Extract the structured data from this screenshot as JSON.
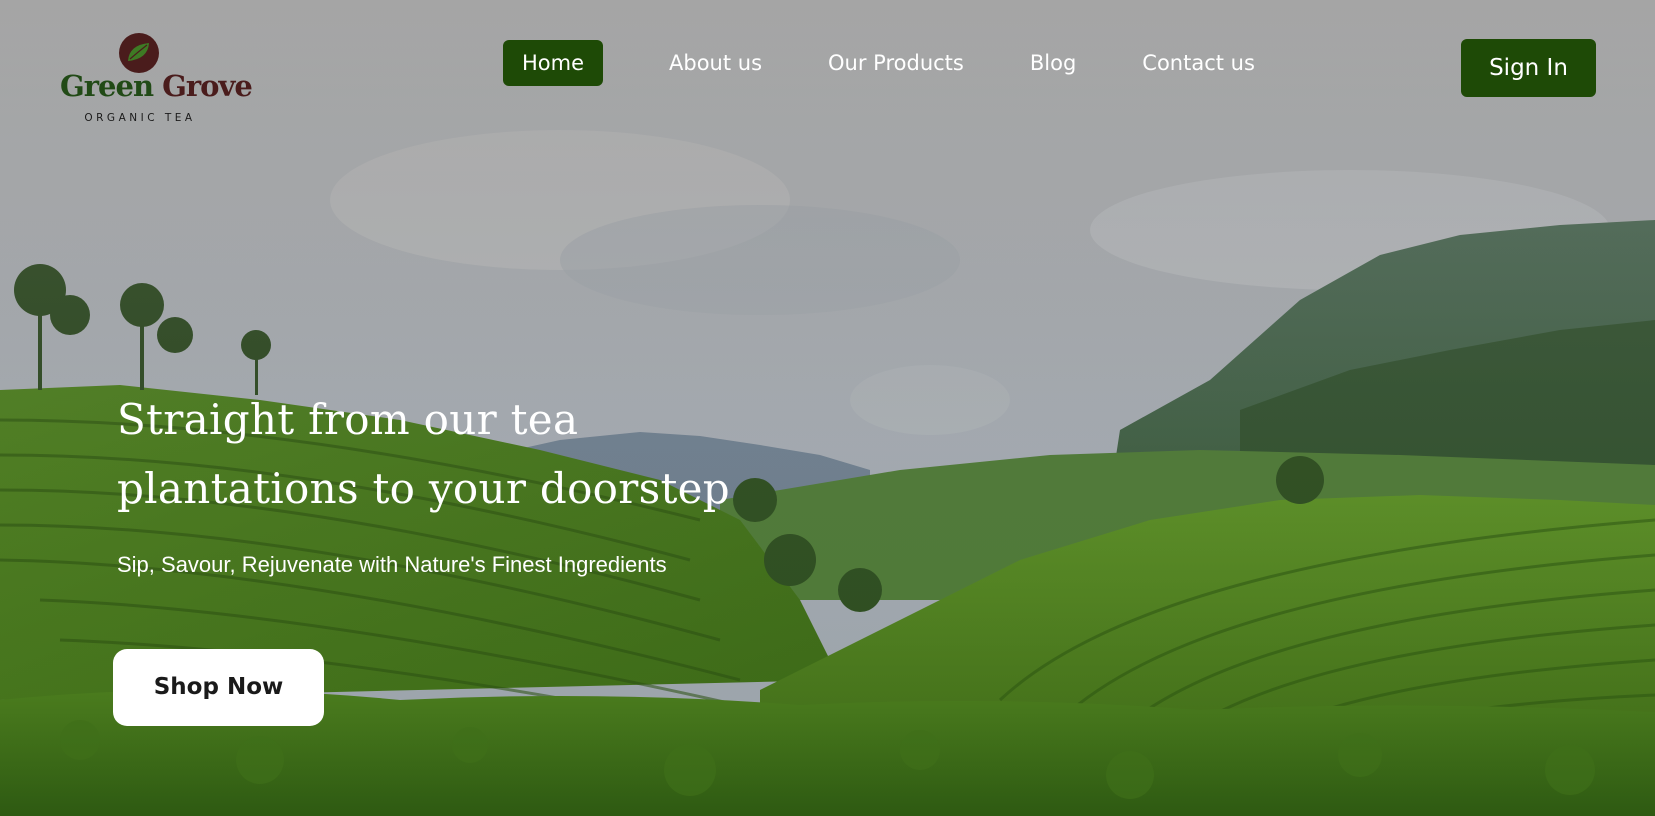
{
  "brand": {
    "name_word1": "Green",
    "name_word2": "Grove",
    "tagline": "ORGANIC TEA",
    "primary_color": "#1e4a06",
    "accent_color": "#4a1c1c",
    "logo_icon": "tea-leaf-icon"
  },
  "nav": {
    "items": [
      {
        "label": "Home",
        "active": true
      },
      {
        "label": "About us",
        "active": false
      },
      {
        "label": "Our Products",
        "active": false
      },
      {
        "label": "Blog",
        "active": false
      },
      {
        "label": "Contact us",
        "active": false
      }
    ]
  },
  "header": {
    "sign_in_label": "Sign In"
  },
  "hero": {
    "title_line1": "Straight from our tea",
    "title_line2": "plantations to your doorstep",
    "subtitle": "Sip, Savour, Rejuvenate with Nature's Finest Ingredients",
    "cta_label": "Shop Now"
  }
}
